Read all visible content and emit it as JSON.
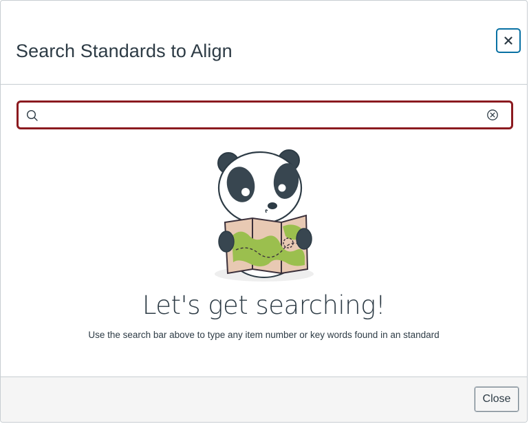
{
  "dialog": {
    "title": "Search Standards to Align",
    "close_icon": "close-icon"
  },
  "search": {
    "value": "",
    "placeholder": "",
    "search_icon": "search-icon",
    "clear_icon": "clear-circle-x-icon"
  },
  "empty_state": {
    "illustration": "panda-with-map-illustration",
    "headline": "Let's get searching!",
    "description": "Use the search bar above to type any item number or key words found in an standard"
  },
  "footer": {
    "close_label": "Close"
  },
  "colors": {
    "text": "#2d3b45",
    "focus_ring": "#8b1a1f",
    "close_button_border": "#0770a3",
    "divider": "#c7cdd1",
    "footer_bg": "#f5f5f5"
  }
}
